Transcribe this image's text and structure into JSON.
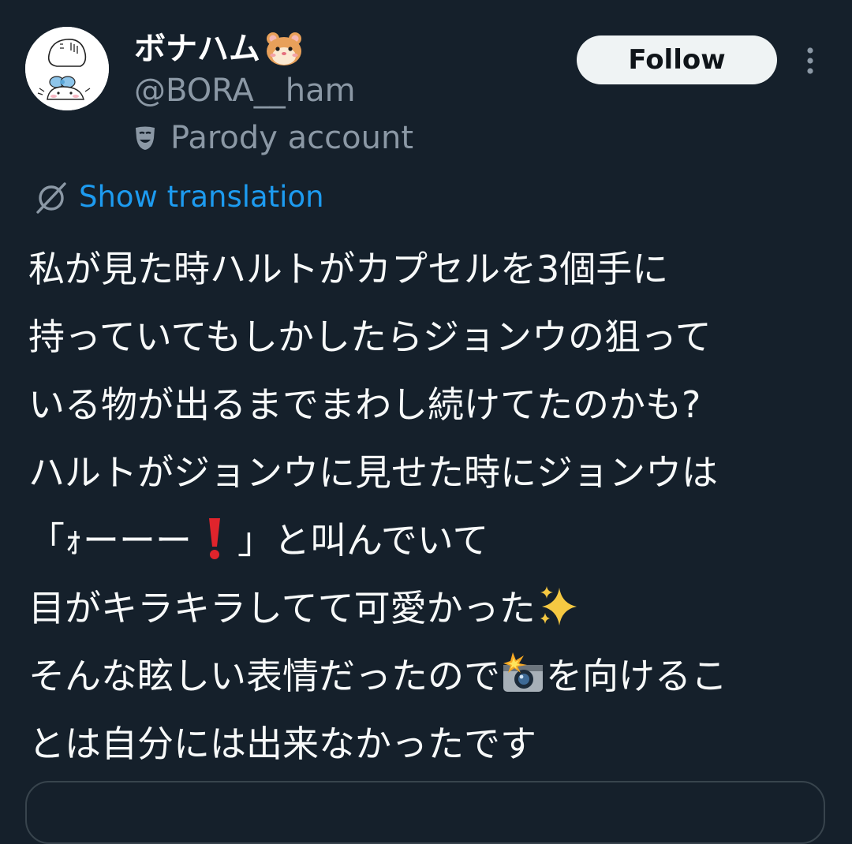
{
  "user": {
    "display_name": "ボナハム",
    "display_name_emoji": "hamster-face-icon",
    "handle": "@BORA__ham",
    "account_label": "Parody account",
    "account_label_icon": "theater-mask-icon"
  },
  "actions": {
    "follow_label": "Follow",
    "more_icon": "more-vertical-icon"
  },
  "translation": {
    "link_label": "Show translation",
    "icon": "translate-icon"
  },
  "tweet": {
    "lines": [
      "私が見た時ハルトがカプセルを3個手に",
      "持っていてもしかしたらジョンウの狙って",
      "いる物が出るまでまわし続けてたのかも?",
      "ハルトがジョンウに見せた時にジョンウは",
      {
        "before": "「ｫーーー",
        "emoji": "red-exclamation-icon",
        "after": "」と叫んでいて"
      },
      {
        "before": "目がキラキラしてて可愛かった",
        "emoji": "sparkles-icon",
        "after": ""
      },
      {
        "before": "そんな眩しい表情だったので",
        "emoji": "camera-flash-icon",
        "after": "を向けるこ"
      },
      "とは自分には出来なかったです"
    ]
  },
  "colors": {
    "background": "#15202b",
    "text_primary": "#f7f9f9",
    "text_secondary": "#8b98a5",
    "link": "#1d9bf0",
    "follow_bg": "#eff3f4",
    "follow_text": "#0f1419",
    "border": "#38444d"
  }
}
